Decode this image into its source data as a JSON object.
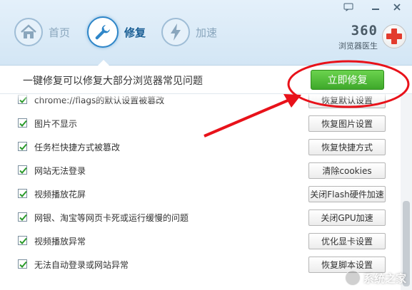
{
  "window": {
    "controls": [
      {
        "name": "feedback-icon",
        "glyph": "💬"
      },
      {
        "name": "minimize-icon",
        "glyph": "—"
      },
      {
        "name": "close-icon",
        "glyph": "✕"
      }
    ]
  },
  "nav": {
    "items": [
      {
        "label": "首页",
        "icon": "home-icon",
        "active": false
      },
      {
        "label": "修复",
        "icon": "wrench-icon",
        "active": true
      },
      {
        "label": "加速",
        "icon": "lightning-icon",
        "active": false
      }
    ]
  },
  "brand": {
    "number": "360",
    "title": "浏览器医生",
    "logo_icon": "red-cross-icon"
  },
  "action": {
    "headline": "一键修复可以修复大部分浏览器常见问题",
    "fix_label": "立即修复"
  },
  "issues": [
    {
      "label": "chrome://flags的默认设置被篡改",
      "action": "恢复默认设置",
      "checked": true
    },
    {
      "label": "图片不显示",
      "action": "恢复图片设置",
      "checked": true
    },
    {
      "label": "任务栏快捷方式被篡改",
      "action": "恢复快捷方式",
      "checked": true
    },
    {
      "label": "网站无法登录",
      "action": "清除cookies",
      "checked": true
    },
    {
      "label": "视频播放花屏",
      "action": "关闭Flash硬件加速",
      "checked": true
    },
    {
      "label": "网银、淘宝等网页卡死或运行缓慢的问题",
      "action": "关闭GPU加速",
      "checked": true
    },
    {
      "label": "视频播放异常",
      "action": "优化显卡设置",
      "checked": true
    },
    {
      "label": "无法自动登录或网站异常",
      "action": "恢复脚本设置",
      "checked": true
    }
  ],
  "watermark": {
    "text": "系统之家"
  },
  "colors": {
    "accent": "#2f86c8",
    "fix_button": "#4cbb32",
    "annotation": "#e8121a",
    "header_bg": "#dcebf7"
  }
}
